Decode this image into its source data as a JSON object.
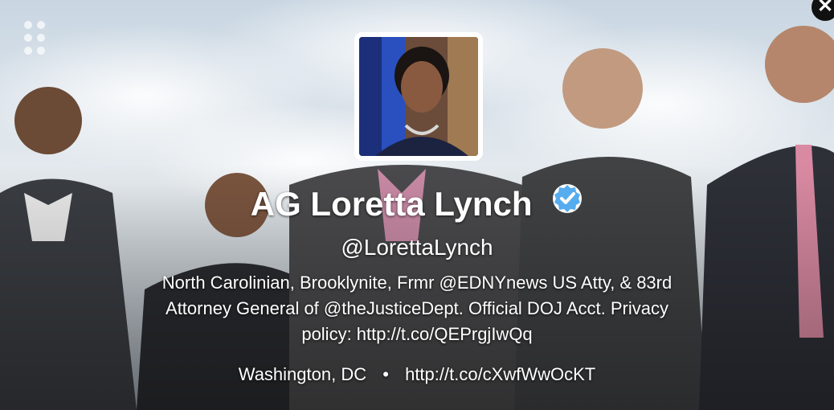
{
  "profile": {
    "name": "AG Loretta Lynch",
    "handle": "@LorettaLynch",
    "bio_lines": [
      "North Carolinian, Brooklynite, Frmr @EDNYnews US Atty, & 83rd",
      "Attorney General of @theJusticeDept. Official DOJ Acct. Privacy",
      "policy: http://t.co/QEPrgjIwQq"
    ],
    "location": "Washington, DC",
    "separator": "•",
    "url": "http://t.co/cXwfWwOcKT",
    "verified": true
  },
  "icons": {
    "grid": "grid-dots-icon",
    "close": "close-icon",
    "verified": "verified-badge-icon"
  },
  "colors": {
    "verified": "#55acee",
    "close_bg": "#111111",
    "text": "#ffffff"
  },
  "close_glyph": "✕"
}
